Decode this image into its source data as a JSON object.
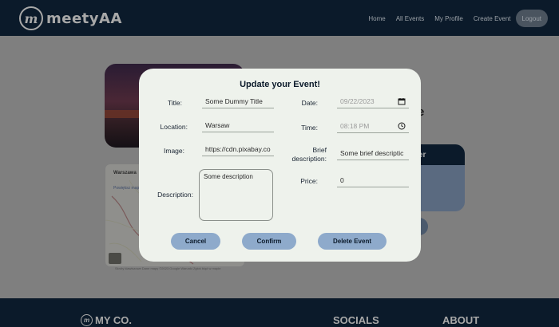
{
  "app": {
    "brand": "meetyAA",
    "logo_letter": "m"
  },
  "nav": {
    "home": "Home",
    "all_events": "All Events",
    "my_profile": "My Profile",
    "create_event": "Create Event",
    "logout": "Logout"
  },
  "background": {
    "title_fragment": "e",
    "card_header": "nizer",
    "map_place": "Warszawa",
    "map_link": "Powiększ mapę",
    "map_credit": "Skróty klawiszowe  Dane mapy ©2023 Google  Warunki  Zgłoś błąd w mapie"
  },
  "modal": {
    "title": "Update your Event!",
    "labels": {
      "title": "Title:",
      "location": "Location:",
      "image": "Image:",
      "description": "Description:",
      "date": "Date:",
      "time": "Time:",
      "brief_description": "Brief description:",
      "price": "Price:"
    },
    "values": {
      "title": "Some Dummy Title",
      "location": "Warsaw",
      "image": "https://cdn.pixabay.co",
      "description": "Some description",
      "date": "09/22/2023",
      "time": "08:18 PM",
      "brief_description": "Some brief descriptic",
      "price": "0"
    },
    "buttons": {
      "cancel": "Cancel",
      "confirm": "Confirm",
      "delete": "Delete Event"
    },
    "icons": {
      "date": "calendar-icon",
      "time": "clock-icon"
    }
  },
  "footer": {
    "brand": "MY CO.",
    "socials": "SOCIALS",
    "about": "ABOUT"
  },
  "colors": {
    "navy": "#0b1a2a",
    "modal_bg": "#eef2ec",
    "button": "#8eaacb",
    "overlay": "#7f7f7f"
  }
}
